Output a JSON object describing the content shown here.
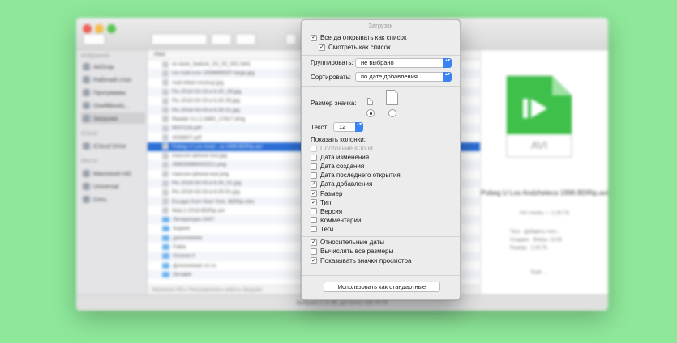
{
  "finder": {
    "sidebar": {
      "favorites_header": "Избранное",
      "favorites": [
        "AirDrop",
        "Рабочий стол",
        "Программы",
        "(SwiftBook)...",
        "Загрузки"
      ],
      "icloud_header": "iCloud",
      "icloud": [
        "iCloud Drive"
      ],
      "places_header": "Места",
      "places": [
        "Macintosh HD",
        "Universal",
        "Сеть"
      ]
    },
    "list_header": "Имя",
    "files": [
      {
        "name": "re-store_feature_03_03_001.html",
        "folder": false
      },
      {
        "name": "ios-mail-icon-1508695537-large.jpg",
        "folder": false
      },
      {
        "name": "mail-tribal-mockup.jpg",
        "folder": false
      },
      {
        "name": "Pic-2018-03-03 в 6.30_39.jpg",
        "folder": false
      },
      {
        "name": "Pic-2018-03-03 в 6.30.39.jpg",
        "folder": false
      },
      {
        "name": "Pic-2018-03-03 в 6.30.31.jpg",
        "folder": false
      },
      {
        "name": "Reeder 3.1.2.3460_17417.dmg",
        "folder": false
      },
      {
        "name": "9037216.pdf",
        "folder": false
      },
      {
        "name": "4038807.pdf",
        "folder": false
      },
      {
        "name": "Pobeg U Los Andz...ia 1999.BDRip.avi",
        "folder": false,
        "selected": true
      },
      {
        "name": "macrum-iphone-lost.jpg",
        "folder": false
      },
      {
        "name": "268539969432521.png",
        "folder": false
      },
      {
        "name": "macrum-iphone-lost.png",
        "folder": false
      },
      {
        "name": "Pic-2018-03-03 в 6.30_51.jpg",
        "folder": false
      },
      {
        "name": "Pic-2018-03-03 в 6.00.51.jpg",
        "folder": false
      },
      {
        "name": "Escape from New York. BDRip.mkv",
        "folder": false
      },
      {
        "name": "Mad.2.2018.BDRip.avi",
        "folder": false
      },
      {
        "name": "Литература 2007",
        "folder": true
      },
      {
        "name": "Superb",
        "folder": true
      },
      {
        "name": "дополнение",
        "folder": true
      },
      {
        "name": "Fabia",
        "folder": true
      },
      {
        "name": "Octavia II",
        "folder": true
      },
      {
        "name": "Дополнение со сс",
        "folder": true
      },
      {
        "name": "Октавія",
        "folder": true
      }
    ],
    "path_bar": "Macintosh HD ▸ Пользователи ▸ artem ▸ Загрузки",
    "status_bar": "Выбрано 1 из 98; доступно 156,78 ГБ",
    "preview": {
      "icon_label": "AVI",
      "name": "Pobeg U Los Andzheleca 1996.BDRip.avi",
      "subtitle": "AVI media — 2,35 ГБ",
      "meta": [
        [
          "Теги",
          "Добавить теги…"
        ],
        [
          "Создано",
          "Вчера, 13:38"
        ],
        [
          "Размер",
          "2,35 ГБ"
        ]
      ],
      "more": "Ещё…"
    }
  },
  "panel": {
    "title": "Загрузки",
    "always_list": {
      "label": "Всегда открывать как список",
      "checked": true
    },
    "browse_list": {
      "label": "Смотреть как список",
      "checked": true
    },
    "group_label": "Группировать:",
    "group_value": "не выбрано",
    "sort_label": "Сортировать:",
    "sort_value": "по дате добавления",
    "icon_size_label": "Размер значка:",
    "text_label": "Текст:",
    "text_size": "12",
    "columns_label": "Показать колонки:",
    "columns": [
      {
        "label": "Состояние iCloud",
        "checked": false,
        "disabled": true
      },
      {
        "label": "Дата изменения",
        "checked": false
      },
      {
        "label": "Дата создания",
        "checked": false
      },
      {
        "label": "Дата последнего открытия",
        "checked": false
      },
      {
        "label": "Дата добавления",
        "checked": true
      },
      {
        "label": "Размер",
        "checked": true
      },
      {
        "label": "Тип",
        "checked": true
      },
      {
        "label": "Версия",
        "checked": false
      },
      {
        "label": "Комментарии",
        "checked": false
      },
      {
        "label": "Теги",
        "checked": false
      }
    ],
    "options": [
      {
        "label": "Относительные даты",
        "checked": true
      },
      {
        "label": "Вычислять все размеры",
        "checked": false
      },
      {
        "label": "Показывать значки просмотра",
        "checked": true
      }
    ],
    "default_button": "Использовать как стандартные",
    "check_glyph": "✓",
    "arrows_glyph": "▴▾"
  },
  "colors": {
    "background": "#8ee89a",
    "accent": "#3b82f2",
    "avi_green": "#3fc04a"
  }
}
